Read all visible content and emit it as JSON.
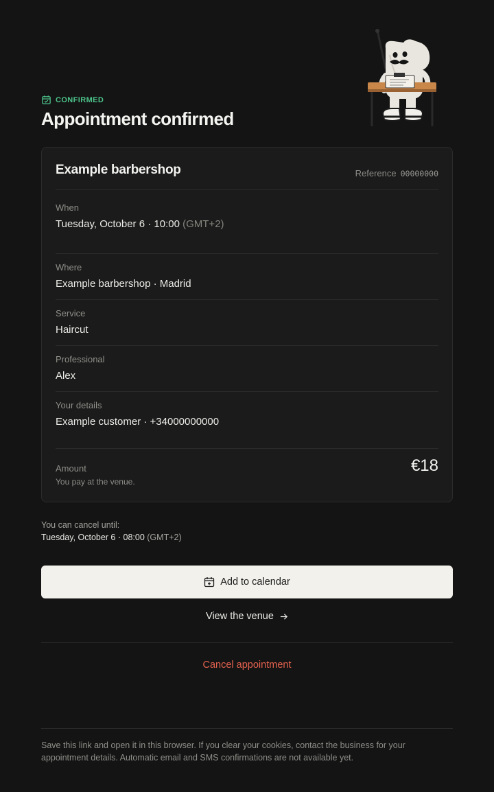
{
  "header": {
    "status_badge": "CONFIRMED",
    "title": "Appointment confirmed"
  },
  "card": {
    "business_name": "Example barbershop",
    "reference_label": "Reference",
    "reference_code": "00000000",
    "fields": [
      {
        "label": "When",
        "value": "Tuesday, October 6 · 10:00",
        "suffix": "(GMT+2)"
      },
      {
        "label": "Where",
        "value": "Example barbershop · Madrid"
      },
      {
        "label": "Service",
        "value": "Haircut"
      },
      {
        "label": "Professional",
        "value": "Alex"
      },
      {
        "label": "Your details",
        "value": "Example customer · +34000000000"
      }
    ],
    "amount": {
      "label": "Amount",
      "note": "You pay at the venue.",
      "value": "€18"
    }
  },
  "cancellation": {
    "label": "You can cancel until:",
    "date": "Tuesday, October 6 · 08:00",
    "timezone": "(GMT+2)"
  },
  "actions": {
    "add_to_calendar": "Add to calendar",
    "view_venue": "View the venue",
    "cancel": "Cancel appointment"
  },
  "footer": {
    "note": "Save this link and open it in this browser. If you clear your cookies, contact the business for your appointment details. Automatic email and SMS confirmations are not available yet."
  },
  "icons": {
    "badge": "calendar-check-icon",
    "calendar_button": "calendar-plus-icon",
    "venue_link": "arrow-right-icon"
  },
  "colors": {
    "background": "#141414",
    "card": "#1b1b1b",
    "confirmed_green": "#4cc38a",
    "cancel_red": "#e5624f",
    "primary_button": "#f2f1ec"
  }
}
